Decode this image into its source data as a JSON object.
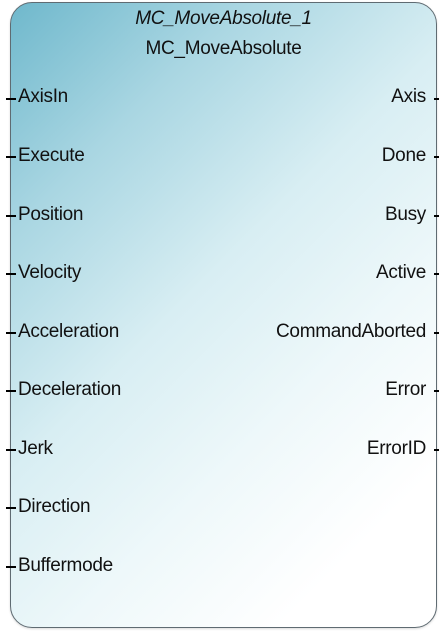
{
  "block": {
    "instance_name": "MC_MoveAbsolute_1",
    "type_name": "MC_MoveAbsolute"
  },
  "inputs": [
    "AxisIn",
    "Execute",
    "Position",
    "Velocity",
    "Acceleration",
    "Deceleration",
    "Jerk",
    "Direction",
    "Buffermode"
  ],
  "outputs": [
    "Axis",
    "Done",
    "Busy",
    "Active",
    "CommandAborted",
    "Error",
    "ErrorID"
  ]
}
